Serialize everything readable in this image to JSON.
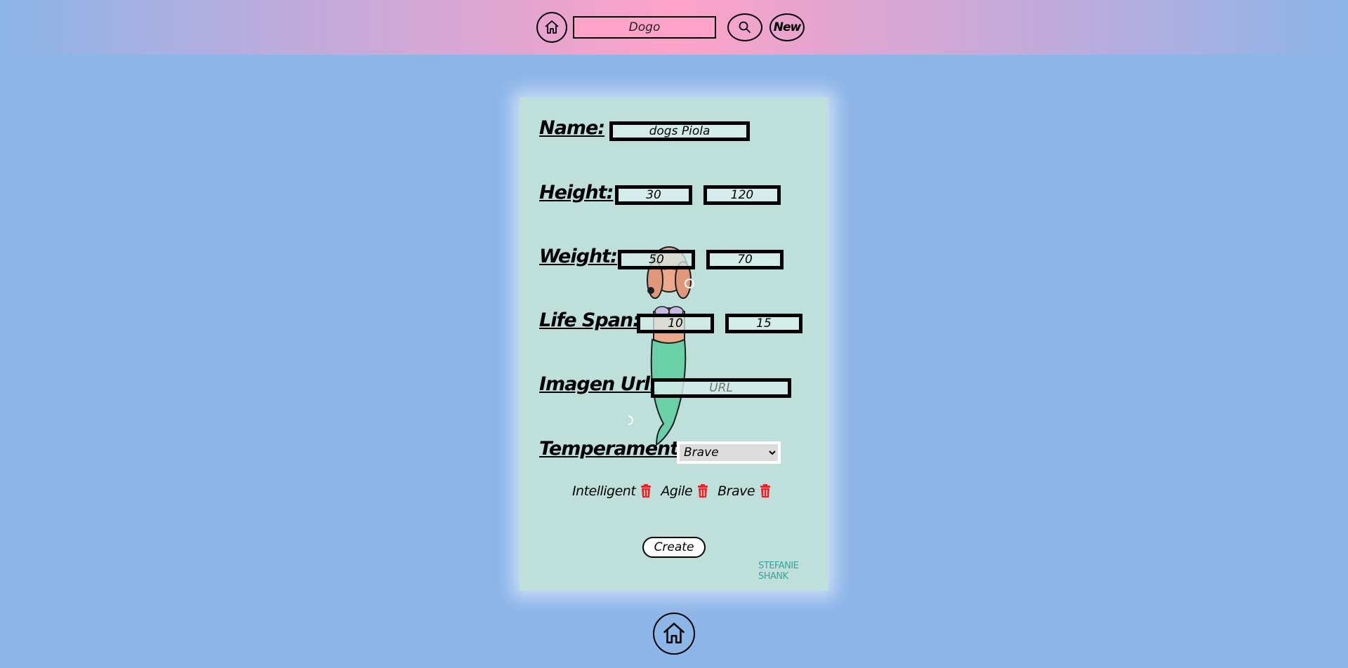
{
  "header": {
    "search_value": "Dogo",
    "new_label": "New"
  },
  "form": {
    "name_label": "Name:",
    "name_value": "dogs Piola",
    "height_label": "Height:",
    "height_min": "30",
    "height_max": "120",
    "weight_label": "Weight:",
    "weight_min": "50",
    "weight_max": "70",
    "lifespan_label": "Life Span:",
    "lifespan_min": "10",
    "lifespan_max": "15",
    "image_label": "Imagen Url:",
    "image_placeholder": "URL",
    "temperaments_label": "Temperaments:",
    "temperament_selected": "Brave",
    "selected_temperaments": [
      "Intelligent",
      "Agile",
      "Brave"
    ],
    "create_label": "Create"
  },
  "decor": {
    "signature": "STEFANIE SHANK"
  },
  "colors": {
    "background": "#8cb5e8",
    "header_pink": "#ffa3c8",
    "card": "#bedfda",
    "trash": "#e3242b"
  },
  "icons": [
    "home-icon",
    "search-icon",
    "trash-icon"
  ]
}
